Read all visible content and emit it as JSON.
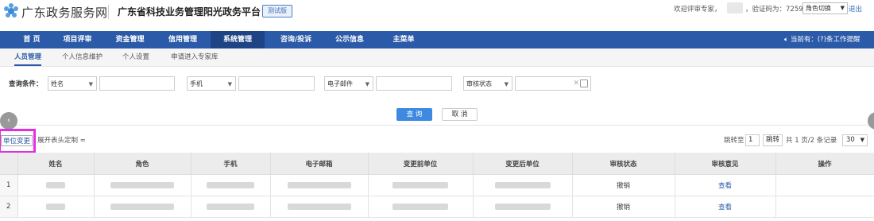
{
  "header": {
    "site_name": "广东政务服务网",
    "platform_name": "广东省科技业务管理阳光政务平台",
    "beta_label": "测试版",
    "welcome_text": "欢迎评审专家，",
    "verify_code_text": "，验证码为：7259",
    "role_switch_label": "角色切换",
    "logout_label": "退出",
    "brand_color": "#2b5aa8"
  },
  "nav": {
    "items": [
      {
        "label": "首 页"
      },
      {
        "label": "项目评审"
      },
      {
        "label": "资金管理"
      },
      {
        "label": "信用管理"
      },
      {
        "label": "系统管理"
      },
      {
        "label": "咨询/投诉"
      },
      {
        "label": "公示信息"
      },
      {
        "label": "主菜单"
      }
    ],
    "active_label": "系统管理",
    "notice_text": "当前有：(?)条工作提醒"
  },
  "subnav": {
    "items": [
      {
        "label": "人员管理"
      },
      {
        "label": "个人信息维护"
      },
      {
        "label": "个人设置"
      },
      {
        "label": "申请进入专家库"
      }
    ]
  },
  "query": {
    "label": "查询条件：",
    "fields": [
      {
        "select": "姓名",
        "value": ""
      },
      {
        "select": "手机",
        "value": ""
      },
      {
        "select": "电子邮件",
        "value": ""
      },
      {
        "select": "审核状态",
        "value": ""
      }
    ],
    "search_button": "查 询",
    "cancel_button": "取 消"
  },
  "toolbar": {
    "unit_change_button": "单位变更",
    "expand_columns": "展开表头定制 ≈",
    "jump_to": "跳转至",
    "page_input": "1",
    "jump_button": "跳转",
    "page_info": "共 1 页/2 条记录",
    "page_size": "30"
  },
  "table": {
    "columns": [
      "姓名",
      "角色",
      "手机",
      "电子邮箱",
      "变更前单位",
      "变更后单位",
      "审核状态",
      "审核意见",
      "操作"
    ],
    "rows": [
      {
        "index": "1",
        "status": "撤销",
        "opinion": "查看"
      },
      {
        "index": "2",
        "status": "撤销",
        "opinion": "查看"
      }
    ]
  }
}
